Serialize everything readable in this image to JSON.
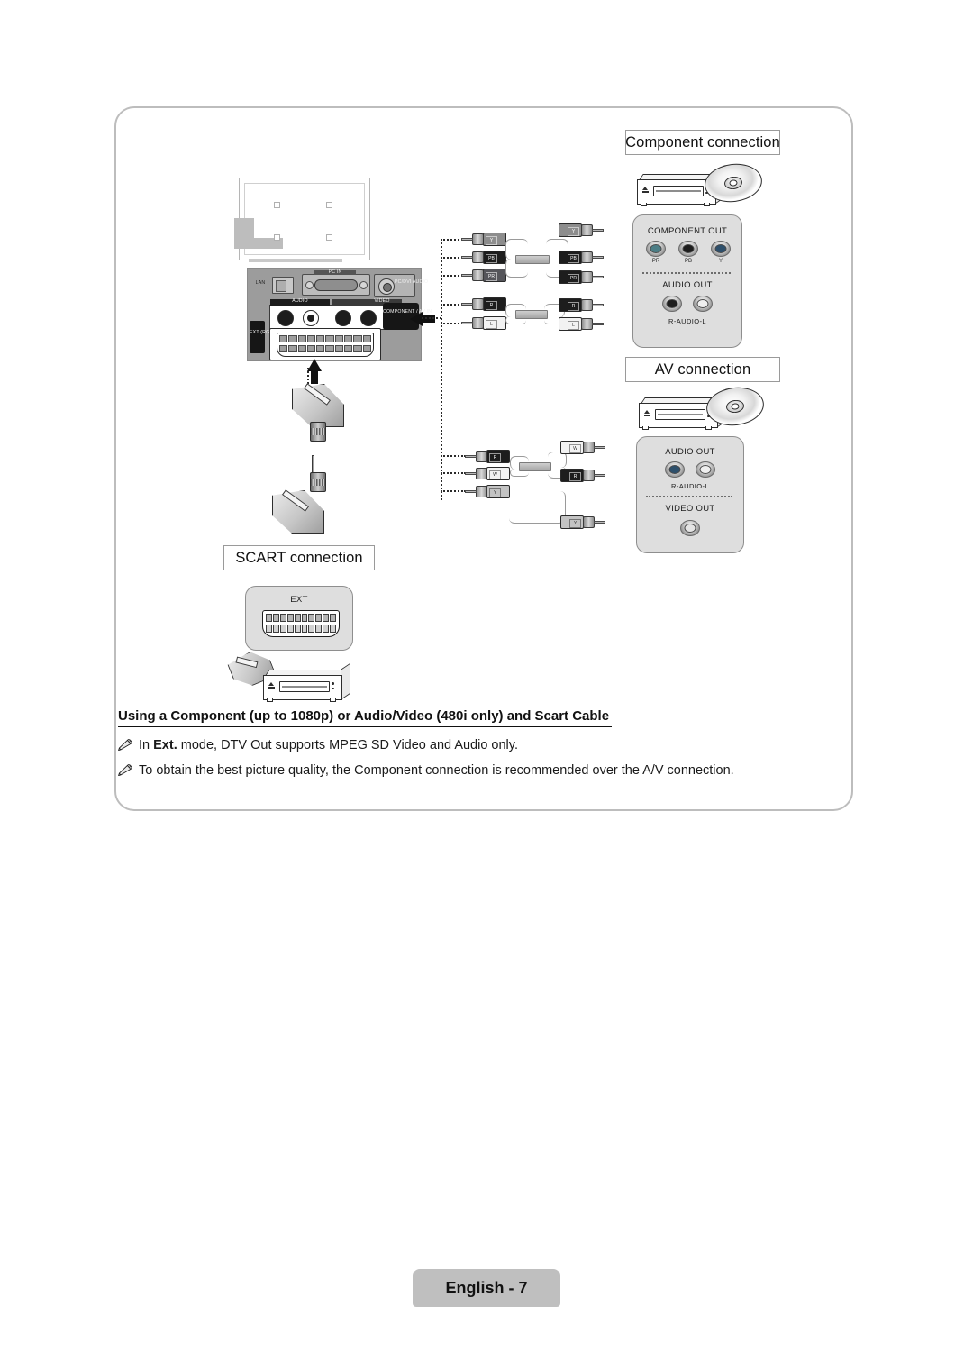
{
  "page": {
    "footer_label": "English - 7"
  },
  "sections": {
    "component": {
      "label": "Component connection",
      "panel": {
        "title": "COMPONENT OUT",
        "pins": [
          "PR",
          "PB",
          "Y"
        ],
        "audio_title": "AUDIO OUT",
        "audio_sub": "R-AUDIO-L"
      }
    },
    "av": {
      "label": "AV connection",
      "panel": {
        "audio_title": "AUDIO OUT",
        "audio_sub": "R-AUDIO-L",
        "video_title": "VIDEO OUT"
      }
    },
    "scart": {
      "label": "SCART connection",
      "panel": {
        "title": "EXT"
      }
    }
  },
  "tv_panel": {
    "lan_label": "LAN",
    "pc_in_label": "PC IN",
    "pc_dvi_audio_label": "PC/DVI AUDIO",
    "audio_label": "AUDIO",
    "video_label": "VIDEO",
    "component_av_in_label": "COMPONENT / AV IN",
    "ext_rgb_label": "EXT (RGB)"
  },
  "cables": {
    "component_cable": {
      "tv_side_plugs": [
        "Y",
        "PB",
        "PR",
        "R",
        "L"
      ],
      "device_side_plugs": [
        "Y",
        "PB",
        "PR",
        "R",
        "L"
      ]
    },
    "av_cable": {
      "tv_side_plugs": [
        "R",
        "W",
        "Y"
      ],
      "device_side_plugs": [
        "W",
        "R",
        "Y"
      ]
    }
  },
  "body": {
    "heading": "Using a Component (up to 1080p) or Audio/Video (480i only) and Scart Cable",
    "note1_prefix": "In ",
    "note1_bold": "Ext.",
    "note1_suffix": " mode, DTV Out supports MPEG SD Video and Audio only.",
    "note2": "To obtain the best picture quality, the Component connection is recommended over the A/V connection."
  },
  "colors": {
    "frame_border": "#bdbdbd",
    "panel_fill": "#dedede",
    "footer_fill": "#bfbfbf",
    "text": "#1a1a1a"
  }
}
